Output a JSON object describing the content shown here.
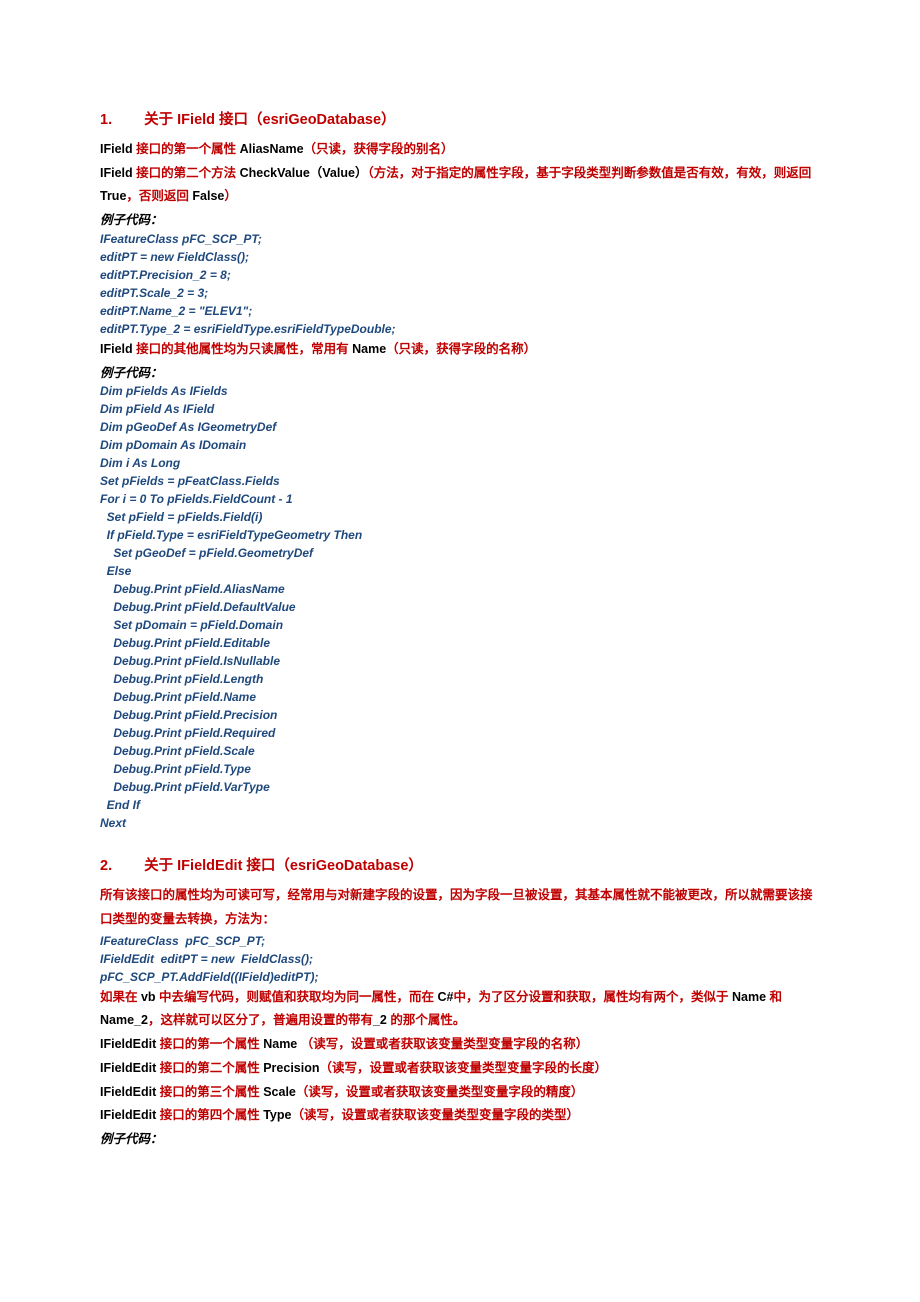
{
  "section1": {
    "num": "1.",
    "title": "关于 IField 接口（esriGeoDatabase）",
    "line1": {
      "pre": "IField ",
      "red1": "接口的第一个属性 ",
      "black1": "AliasName",
      "red2": "（只读，获得字段的别名）"
    },
    "line2": {
      "pre": "IField ",
      "red1": "接口的第二个方法 ",
      "black1": "CheckValue（Value）",
      "red2": "（方法，对于指定的属性字段，基于字段类型判断参数值是否有效，有效，则返回 ",
      "black2": "True",
      "red3": "，否则返回 ",
      "black3": "False",
      "red4": "）"
    },
    "example1_label": "例子代码：",
    "code1": [
      "IFeatureClass pFC_SCP_PT;",
      "editPT = new FieldClass();",
      "editPT.Precision_2 = 8;",
      "editPT.Scale_2 = 3;",
      "editPT.Name_2 = \"ELEV1\";",
      "editPT.Type_2 = esriFieldType.esriFieldTypeDouble;"
    ],
    "line3": {
      "pre": "IField ",
      "red1": "接口的其他属性均为只读属性，常用有 ",
      "black1": "Name",
      "red2": "（只读，获得字段的名称）"
    },
    "example2_label": "例子代码：",
    "code2": [
      "Dim pFields As IFields",
      "Dim pField As IField",
      "Dim pGeoDef As IGeometryDef",
      "Dim pDomain As IDomain",
      "Dim i As Long",
      "Set pFields = pFeatClass.Fields",
      "For i = 0 To pFields.FieldCount - 1",
      "  Set pField = pFields.Field(i)",
      "  If pField.Type = esriFieldTypeGeometry Then",
      "    Set pGeoDef = pField.GeometryDef",
      "  Else",
      "    Debug.Print pField.AliasName",
      "    Debug.Print pField.DefaultValue",
      "    Set pDomain = pField.Domain",
      "    Debug.Print pField.Editable",
      "    Debug.Print pField.IsNullable",
      "    Debug.Print pField.Length",
      "    Debug.Print pField.Name",
      "    Debug.Print pField.Precision",
      "    Debug.Print pField.Required",
      "    Debug.Print pField.Scale",
      "    Debug.Print pField.Type",
      "    Debug.Print pField.VarType",
      "  End If",
      "Next"
    ]
  },
  "section2": {
    "num": "2.",
    "title": "关于 IFieldEdit 接口（esriGeoDatabase）",
    "para1": "所有该接口的属性均为可读可写，经常用与对新建字段的设置，因为字段一旦被设置，其基本属性就不能被更改，所以就需要该接口类型的变量去转换，方法为：",
    "code1": [
      "IFeatureClass  pFC_SCP_PT;",
      "IFieldEdit  editPT = new  FieldClass();",
      "pFC_SCP_PT.AddField((IField)editPT);"
    ],
    "para2": {
      "red1": "如果在 ",
      "black1": "vb ",
      "red2": "中去编写代码，则赋值和获取均为同一属性，而在 ",
      "black2": "C#",
      "red3": "中，为了区分设置和获取，属性均有两个，类似于 ",
      "black3": "Name ",
      "red4": "和 ",
      "black4": "Name_2",
      "red5": "，这样就可以区分了，普遍用设置的带有",
      "black5": "_2 ",
      "red6": "的那个属性。"
    },
    "line1": {
      "pre": "IFieldEdit ",
      "red1": "接口的第一个属性 ",
      "black1": "Name  ",
      "red2": "（读写，设置或者获取该变量类型变量字段的名称）"
    },
    "line2": {
      "pre": "IFieldEdit ",
      "red1": "接口的第二个属性 ",
      "black1": "Precision",
      "red2": "（读写，设置或者获取该变量类型变量字段的长度）"
    },
    "line3": {
      "pre": "IFieldEdit ",
      "red1": "接口的第三个属性 ",
      "black1": "Scale",
      "red2": "（读写，设置或者获取该变量类型变量字段的精度）"
    },
    "line4": {
      "pre": "IFieldEdit ",
      "red1": "接口的第四个属性 ",
      "black1": "Type",
      "red2": "（读写，设置或者获取该变量类型变量字段的类型）"
    },
    "example_label": "例子代码："
  }
}
